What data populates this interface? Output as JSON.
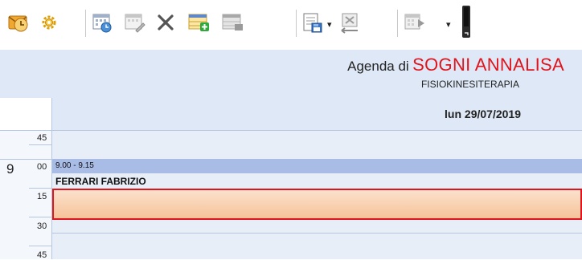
{
  "toolbar": {
    "buttons": [
      {
        "name": "envelope-clock-icon"
      },
      {
        "name": "gear-icon"
      },
      {
        "name": "calendar-clock-icon"
      },
      {
        "name": "calendar-edit-icon"
      },
      {
        "name": "delete-x-icon"
      },
      {
        "name": "add-row-icon"
      },
      {
        "name": "grid-disabled-icon"
      },
      {
        "name": "export-save-icon"
      },
      {
        "name": "cancel-box-icon"
      },
      {
        "name": "calendar-arrow-icon"
      },
      {
        "name": "phone-icon"
      }
    ],
    "accent": "#1e7bd8",
    "dropdown_glyph": "▾"
  },
  "header": {
    "prefix": "Agenda di",
    "name": "SOGNI ANNALISA",
    "subtitle": "FISIOKINESITERAPIA",
    "name_color": "#e0141c"
  },
  "day": {
    "label": "lun 29/07/2019"
  },
  "grid": {
    "labels": [
      "45",
      "9",
      "00",
      "15",
      "30",
      "45"
    ]
  },
  "appointment": {
    "time": "9.00 - 9.15",
    "patient": "FERRARI FABRIZIO",
    "header_color": "#a9bce6"
  }
}
